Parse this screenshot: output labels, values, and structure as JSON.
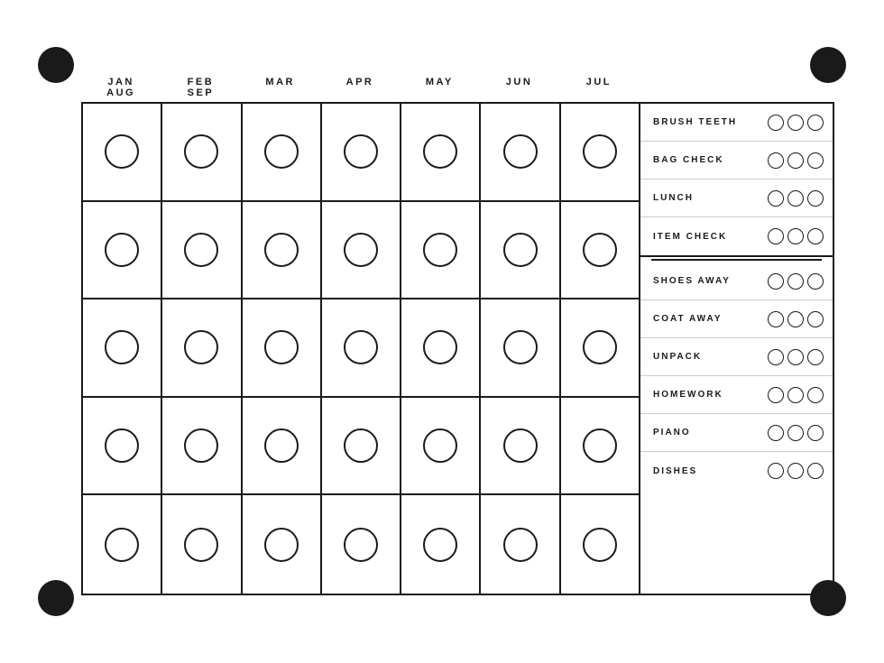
{
  "months": [
    "JAN",
    "FEB",
    "MAR",
    "APR",
    "MAY",
    "JUN",
    "JUL",
    "AUG",
    "SEP"
  ],
  "grid": {
    "rows": 5,
    "cols": 7
  },
  "tasks_group1": [
    {
      "label": "BRUSH TEETH",
      "circles": 3
    },
    {
      "label": "BAG CHECK",
      "circles": 3
    },
    {
      "label": "LUNCH",
      "circles": 3
    },
    {
      "label": "ITEM CHECK",
      "circles": 3
    }
  ],
  "tasks_group2": [
    {
      "label": "SHOES AWAY",
      "circles": 3
    },
    {
      "label": "COAT AWAY",
      "circles": 3
    },
    {
      "label": "UNPACK",
      "circles": 3
    },
    {
      "label": "HOMEWORK",
      "circles": 3
    },
    {
      "label": "PIANO",
      "circles": 3
    },
    {
      "label": "DISHES",
      "circles": 3
    }
  ],
  "corners": {
    "tl": "●",
    "tr": "●",
    "bl": "●",
    "br": "●"
  }
}
